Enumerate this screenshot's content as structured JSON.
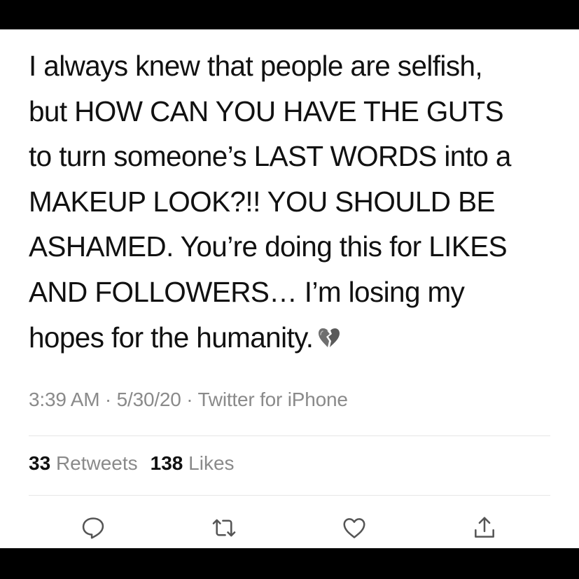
{
  "tweet": {
    "lines": [
      "I always knew that people are selfish,",
      "but HOW CAN YOU HAVE THE GUTS",
      "to turn someone’s LAST WORDS into a",
      "MAKEUP LOOK?!!  YOU SHOULD BE",
      "ASHAMED. You’re doing this for LIKES",
      "AND FOLLOWERS… I’m losing my",
      "hopes for the humanity."
    ],
    "emoji": "broken-heart-icon"
  },
  "meta": {
    "time": "3:39 AM",
    "separator": " · ",
    "date": "5/30/20",
    "source": "Twitter for iPhone"
  },
  "stats": {
    "retweets_count": "33",
    "retweets_label": "Retweets",
    "likes_count": "138",
    "likes_label": "Likes"
  },
  "actions": [
    {
      "icon": "reply-icon"
    },
    {
      "icon": "retweet-icon"
    },
    {
      "icon": "like-icon"
    },
    {
      "icon": "share-icon"
    }
  ],
  "colors": {
    "text": "#111111",
    "muted": "#8a8a8a",
    "divider": "#e6e6e6",
    "frame": "#000000",
    "background": "#ffffff"
  }
}
